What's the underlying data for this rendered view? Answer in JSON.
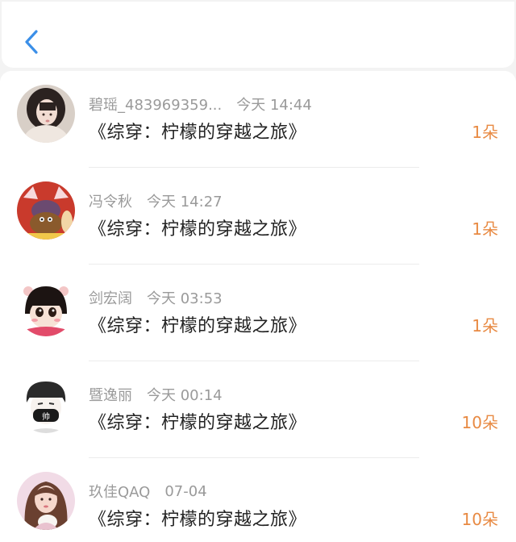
{
  "header": {
    "back_icon": "chevron-left-icon",
    "accent_color": "#3b8fe8"
  },
  "gifts": [
    {
      "name": "碧瑶_483969359...",
      "time": "今天 14:44",
      "title": "《综穿：柠檬的穿越之旅》",
      "amount": "1朵"
    },
    {
      "name": "冯令秋",
      "time": "今天 14:27",
      "title": "《综穿：柠檬的穿越之旅》",
      "amount": "1朵"
    },
    {
      "name": "剑宏阔",
      "time": "今天 03:53",
      "title": "《综穿：柠檬的穿越之旅》",
      "amount": "1朵"
    },
    {
      "name": "暨逸丽",
      "time": "今天 00:14",
      "title": "《综穿：柠檬的穿越之旅》",
      "amount": "10朵"
    },
    {
      "name": "玖佳QAQ",
      "time": "07-04",
      "title": "《综穿：柠檬的穿越之旅》",
      "amount": "10朵"
    }
  ],
  "colors": {
    "amount": "#e88a43",
    "meta_text": "#9a9a9a",
    "title_text": "#222222"
  }
}
